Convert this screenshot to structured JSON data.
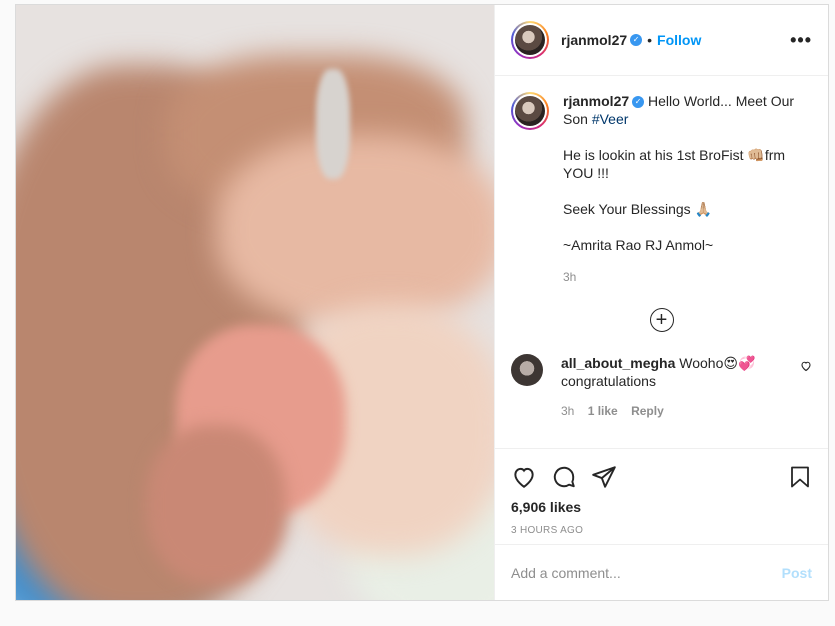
{
  "header": {
    "username": "rjanmol27",
    "verified_icon": "verified-badge-icon",
    "separator": "•",
    "follow_label": "Follow",
    "more_label": "•••"
  },
  "caption": {
    "username": "rjanmol27",
    "line1": "Hello World... Meet Our Son",
    "hashtag": "#Veer",
    "line2": "He is lookin at his 1st BroFist 👊🏼frm YOU !!!",
    "line3": "Seek Your Blessings 🙏🏼",
    "line4": "~Amrita Rao RJ Anmol~",
    "time": "3h"
  },
  "load_more_symbol": "+",
  "comments": [
    {
      "username": "all_about_megha",
      "text": "Wooho😍💞 congratulations",
      "time": "3h",
      "likes": "1 like",
      "reply_label": "Reply"
    }
  ],
  "actions": {
    "likes": "6,906 likes",
    "posted_ago": "3 HOURS AGO"
  },
  "add_comment": {
    "placeholder": "Add a comment...",
    "post_label": "Post"
  },
  "colors": {
    "accent": "#0095f6",
    "post_disabled": "#b2dffc",
    "meta_gray": "#8e8e8e"
  }
}
